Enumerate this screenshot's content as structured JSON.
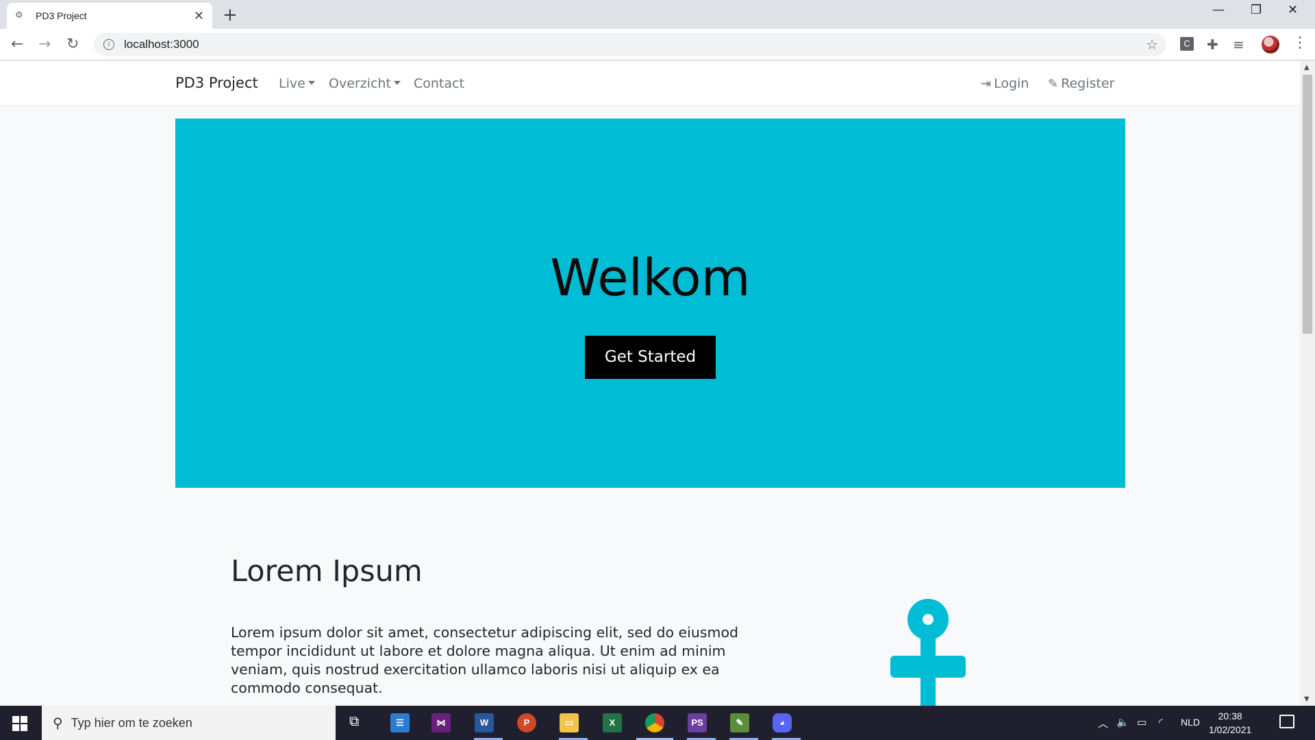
{
  "browser": {
    "tab_title": "PD3 Project",
    "url": "localhost:3000"
  },
  "site": {
    "brand": "PD3 Project",
    "nav": {
      "live": "Live",
      "overzicht": "Overzicht",
      "contact": "Contact",
      "login": "Login",
      "register": "Register"
    },
    "hero": {
      "title": "Welkom",
      "button": "Get Started"
    },
    "section": {
      "title": "Lorem Ipsum",
      "text": "Lorem ipsum dolor sit amet, consectetur adipiscing elit, sed do eiusmod tempor incididunt ut labore et dolore magna aliqua. Ut enim ad minim veniam, quis nostrud exercitation ullamco laboris nisi ut aliquip ex ea commodo consequat."
    }
  },
  "taskbar": {
    "search_placeholder": "Typ hier om te zoeken",
    "language": "NLD",
    "time": "20:38",
    "date": "1/02/2021"
  },
  "colors": {
    "hero_bg": "#00bcd4",
    "button_bg": "#000000",
    "accent_icon": "#00bcd4"
  },
  "icons": [
    "gear-favicon",
    "info-icon",
    "star-icon",
    "extension-icon",
    "sign-in-icon",
    "pencil-icon",
    "female-symbol-icon",
    "windows-start-icon",
    "search-icon"
  ]
}
